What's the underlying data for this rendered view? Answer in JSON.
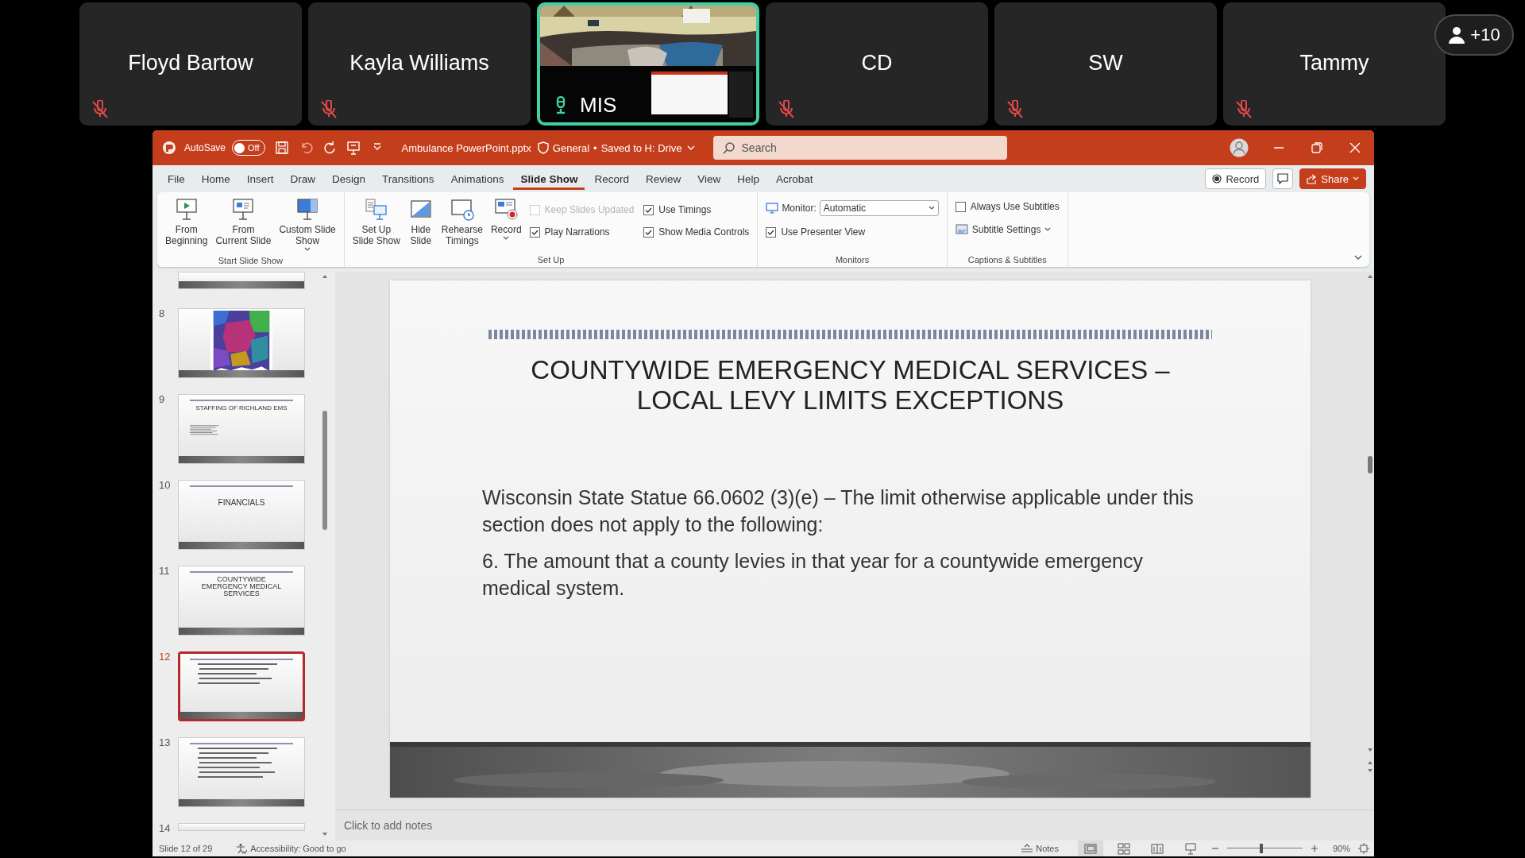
{
  "participants": [
    {
      "name": "Floyd Bartow",
      "muted": true,
      "video": false
    },
    {
      "name": "Kayla Williams",
      "muted": true,
      "video": false
    },
    {
      "name": "MIS",
      "muted": false,
      "video": true
    },
    {
      "name": "CD",
      "muted": true,
      "video": false
    },
    {
      "name": "SW",
      "muted": true,
      "video": false
    },
    {
      "name": "Tammy",
      "muted": true,
      "video": false
    }
  ],
  "overflow_count": "+10",
  "window": {
    "autosave_label": "AutoSave",
    "autosave_state": "Off",
    "autosave_on": false,
    "file_name": "Ambulance PowerPoint.pptx",
    "sensitivity": "General",
    "separator": "•",
    "save_status": "Saved to H: Drive",
    "search": {
      "placeholder": "Search"
    }
  },
  "tabs": [
    {
      "label": "File",
      "selected": false
    },
    {
      "label": "Home",
      "selected": false
    },
    {
      "label": "Insert",
      "selected": false
    },
    {
      "label": "Draw",
      "selected": false
    },
    {
      "label": "Design",
      "selected": false
    },
    {
      "label": "Transitions",
      "selected": false
    },
    {
      "label": "Animations",
      "selected": false
    },
    {
      "label": "Slide Show",
      "selected": true
    },
    {
      "label": "Record",
      "selected": false
    },
    {
      "label": "Review",
      "selected": false
    },
    {
      "label": "View",
      "selected": false
    },
    {
      "label": "Help",
      "selected": false
    },
    {
      "label": "Acrobat",
      "selected": false
    }
  ],
  "tab_actions": [
    {
      "kind": "record",
      "label": "Record"
    },
    {
      "kind": "comments"
    },
    {
      "kind": "share",
      "label": "Share"
    }
  ],
  "ribbon_groups": [
    {
      "title": "Start Slide Show",
      "items": [
        {
          "kind": "button",
          "lines": [
            "From",
            "Beginning"
          ],
          "dropdown": false
        },
        {
          "kind": "button",
          "lines": [
            "From",
            "Current Slide"
          ],
          "dropdown": false
        },
        {
          "kind": "button",
          "lines": [
            "Custom Slide",
            "Show"
          ],
          "dropdown": true
        }
      ]
    },
    {
      "title": "Set Up",
      "items": [
        {
          "kind": "button",
          "lines": [
            "Set Up",
            "Slide Show"
          ],
          "dropdown": false
        },
        {
          "kind": "button",
          "lines": [
            "Hide",
            "Slide"
          ],
          "dropdown": false
        },
        {
          "kind": "button",
          "lines": [
            "Rehearse",
            "Timings"
          ],
          "dropdown": false
        },
        {
          "kind": "button",
          "lines": [
            "Record"
          ],
          "dropdown": true
        },
        {
          "kind": "checks",
          "columns": [
            [
              {
                "label": "Keep Slides Updated",
                "checked": false,
                "disabled": true
              },
              {
                "label": "Play Narrations",
                "checked": true,
                "disabled": false
              }
            ],
            [
              {
                "label": "Use Timings",
                "checked": true,
                "disabled": false
              },
              {
                "label": "Show Media Controls",
                "checked": true,
                "disabled": false
              }
            ]
          ]
        }
      ]
    },
    {
      "title": "Monitors",
      "items": [
        {
          "kind": "stack",
          "rows": [
            {
              "kind": "select",
              "label": "Monitor:",
              "value": "Automatic"
            },
            {
              "kind": "checkbox",
              "label": "Use Presenter View",
              "checked": true,
              "disabled": false
            }
          ]
        }
      ]
    },
    {
      "title": "Captions & Subtitles",
      "items": [
        {
          "kind": "stack",
          "rows": [
            {
              "kind": "checkbox",
              "label": "Always Use Subtitles",
              "checked": false,
              "disabled": false
            },
            {
              "kind": "menu",
              "label": "Subtitle Settings"
            }
          ]
        }
      ]
    }
  ],
  "thumbnails": [
    {
      "kind": "partial",
      "selected": false
    },
    {
      "kind": "map",
      "number": "8",
      "selected": false
    },
    {
      "kind": "list",
      "number": "9",
      "title": "STAFFING OF RICHLAND EMS",
      "selected": false
    },
    {
      "kind": "section",
      "number": "10",
      "title": "FINANCIALS",
      "selected": false
    },
    {
      "kind": "heading",
      "number": "11",
      "title": "COUNTYWIDE EMERGENCY MEDICAL SERVICES",
      "selected": false
    },
    {
      "kind": "lines",
      "number": "12",
      "selected": true
    },
    {
      "kind": "lines",
      "number": "13",
      "selected": false
    },
    {
      "kind": "cut",
      "number": "14",
      "selected": false
    }
  ],
  "slide": {
    "title_lines": [
      "COUNTYWIDE EMERGENCY MEDICAL SERVICES –",
      "LOCAL LEVY LIMITS EXCEPTIONS"
    ],
    "paragraphs": [
      "Wisconsin State Statue 66.0602 (3)(e) – The limit otherwise applicable under this section does not apply to the following:",
      "6. The amount that a county levies in that year for a countywide emergency medical system."
    ]
  },
  "notes": {
    "placeholder": "Click to add notes"
  },
  "status_bar": {
    "slide_position": "Slide 12 of 29",
    "accessibility": "Accessibility: Good to go",
    "notes": "Notes",
    "views": [
      {
        "selected": true
      },
      {
        "selected": false
      },
      {
        "selected": false
      },
      {
        "selected": false
      }
    ],
    "zoom": {
      "level": 0.45,
      "reading": "90%"
    }
  }
}
